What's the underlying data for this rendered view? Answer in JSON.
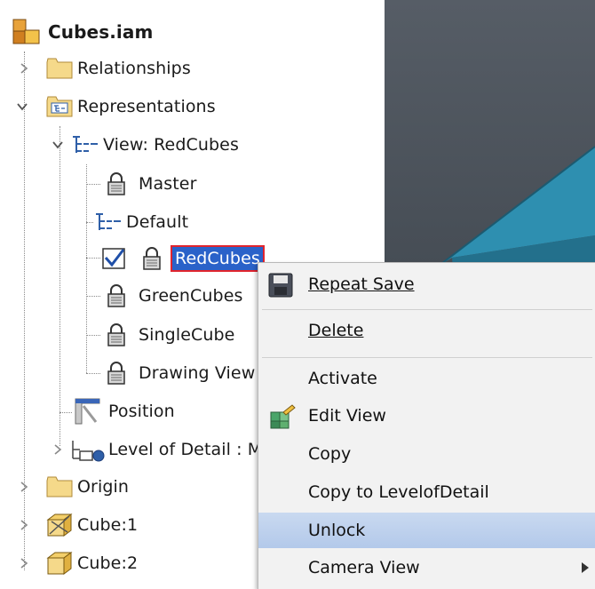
{
  "tree": {
    "root": "Cubes.iam",
    "relationships": "Relationships",
    "representations": "Representations",
    "view": "View: RedCubes",
    "master": "Master",
    "default": "Default",
    "redcubes": "RedCubes",
    "greencubes": "GreenCubes",
    "singlecube": "SingleCube",
    "drawingview": "Drawing View",
    "position": "Position",
    "lod": "Level of Detail : Maste",
    "origin": "Origin",
    "cube1": "Cube:1",
    "cube2": "Cube:2"
  },
  "menu": {
    "repeat_save": "Repeat Save",
    "delete": "Delete",
    "activate": "Activate",
    "edit_view": "Edit View",
    "copy": "Copy",
    "copy_to_lod": "Copy to LevelofDetail",
    "unlock": "Unlock",
    "camera_view": "Camera View"
  },
  "colors": {
    "selection": "#2a62c9",
    "selection_border": "#e0242e",
    "menu_hover": "#b3c9ea",
    "viewport_cube": "#2e8fb0"
  }
}
